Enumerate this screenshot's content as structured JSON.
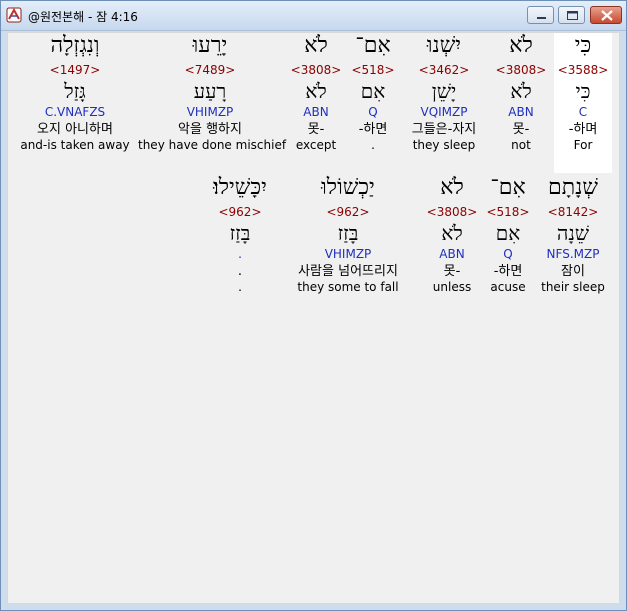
{
  "window": {
    "title": "@원전본해 - 잠 4:16",
    "accent": "#6d8fb8",
    "close_color": "#c74a2f"
  },
  "rows": [
    {
      "words": [
        {
          "heb": "כִּי",
          "strong": "<3588>",
          "root": "כִּי",
          "gram": "C",
          "kor": "-하며",
          "eng": "For",
          "highlight": true
        },
        {
          "heb": "לֹא",
          "strong": "<3808>",
          "root": "לֹא",
          "gram": "ABN",
          "kor": "못-",
          "eng": "not"
        },
        {
          "heb": "יִשְׁנוּ",
          "strong": "<3462>",
          "root": "יָשֵׁן",
          "gram": "VQIMZP",
          "kor": "그들은-자지",
          "eng": "they sleep"
        },
        {
          "heb": "אִם־",
          "strong": "<518>",
          "root": "אִם",
          "gram": "Q",
          "kor": "-하면",
          "eng": "."
        },
        {
          "heb": "לֹא",
          "strong": "<3808>",
          "root": "לֹא",
          "gram": "ABN",
          "kor": "못-",
          "eng": "except"
        },
        {
          "heb": "יָרֵעוּ",
          "strong": "<7489>",
          "root": "רָעַע",
          "gram": "VHIMZP",
          "kor": "악을 행하지",
          "eng": "they have done mischief"
        },
        {
          "heb": "וְנִגְזְלָה",
          "strong": "<1497>",
          "root": "גָּזַל",
          "gram": "C.VNAFZS",
          "kor": "오지 아니하며",
          "eng": "and-is taken away"
        }
      ]
    },
    {
      "words": [
        {
          "heb": "שְׁנָתָם",
          "strong": "<8142>",
          "root": "שֵׁנָה",
          "gram": "NFS.MZP",
          "kor": "잠이",
          "eng": "their sleep"
        },
        {
          "heb": "אִם־",
          "strong": "<518>",
          "root": "אִם",
          "gram": "Q",
          "kor": "-하면",
          "eng": "acuse"
        },
        {
          "heb": "לֹא",
          "strong": "<3808>",
          "root": "לֹא",
          "gram": "ABN",
          "kor": "못-",
          "eng": "unless"
        },
        {
          "heb": "יַכְשׁוֹלוּ",
          "strong": "<962>",
          "root": "בָּזַז",
          "gram": "VHIMZP",
          "kor": "사람을 넘어뜨리지",
          "eng": "they some to fall"
        },
        {
          "heb": "יִכָּשֵׁילוּ׃",
          "strong": "<962>",
          "root": "בָּזַז",
          "gram": ".",
          "kor": ".",
          "eng": "."
        }
      ]
    }
  ]
}
